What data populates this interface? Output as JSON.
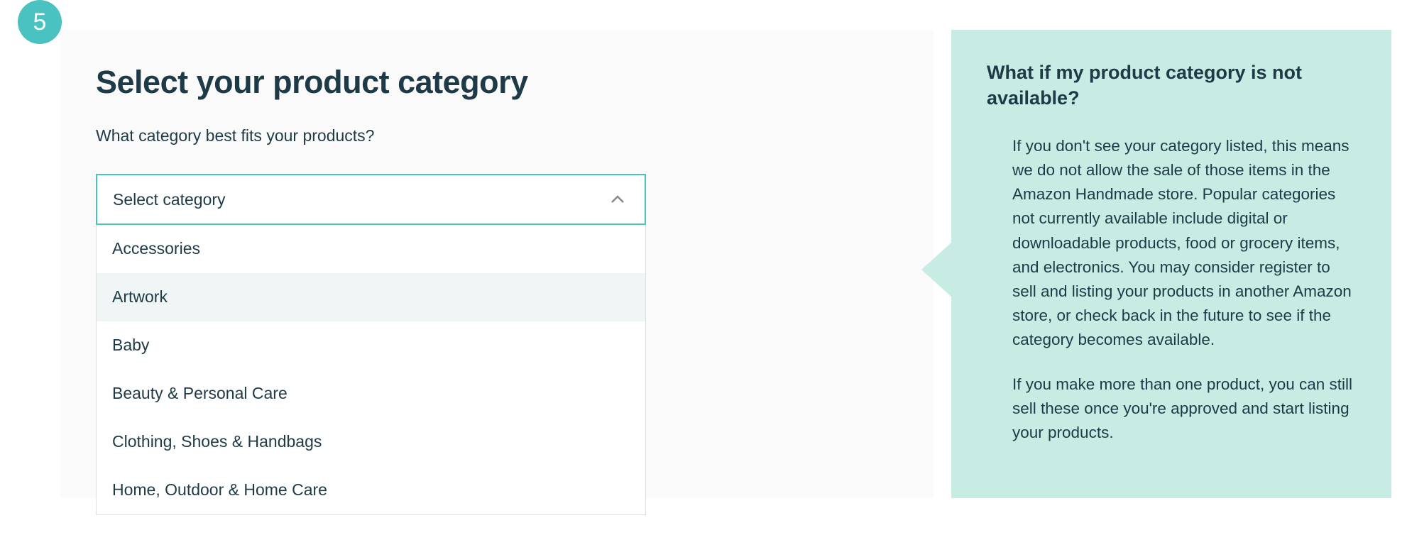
{
  "step_number": "5",
  "main": {
    "title": "Select your product category",
    "subtitle": "What category best fits your products?",
    "select_placeholder": "Select category",
    "options": [
      "Accessories",
      "Artwork",
      "Baby",
      "Beauty & Personal Care",
      "Clothing, Shoes & Handbags",
      "Home, Outdoor & Home Care"
    ],
    "hovered_index": 1
  },
  "callout": {
    "title": "What if my product category is not available?",
    "paragraph1": "If you don't see your category listed, this means we do not allow the sale of those items in the Amazon Handmade store. Popular categories not currently available include digital or downloadable products, food or grocery items, and electronics. You may consider register to sell and listing your products in another Amazon store, or check back in the future to see if the category becomes available.",
    "paragraph2": "If you make more than one product, you can still sell these once you're approved and start listing your products."
  }
}
